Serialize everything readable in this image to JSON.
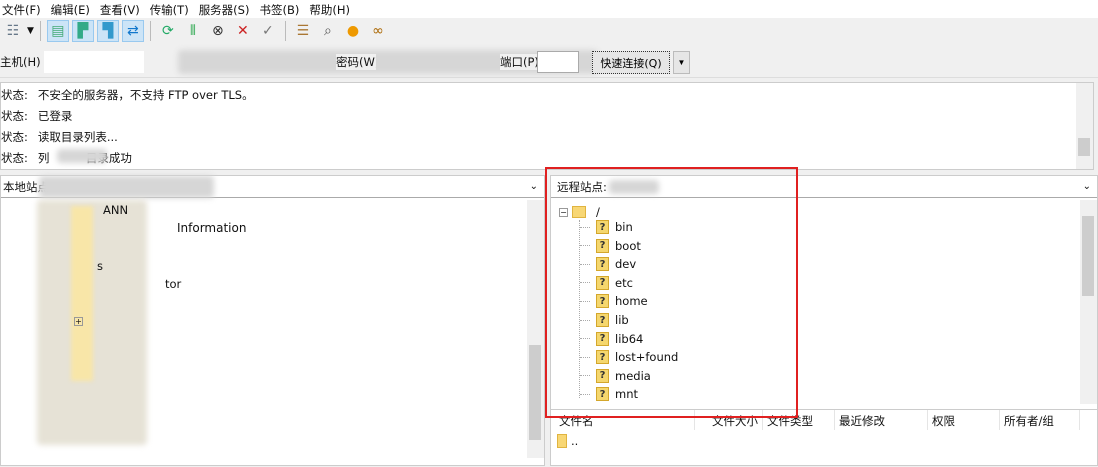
{
  "menu": [
    "文件(F)",
    "编辑(E)",
    "查看(V)",
    "传输(T)",
    "服务器(S)",
    "书签(B)",
    "帮助(H)"
  ],
  "toolbar": {
    "icons": [
      "site-manager-icon",
      "toggle-log-icon",
      "toggle-local-tree-icon",
      "toggle-remote-tree-icon",
      "toggle-queue-icon",
      "refresh-icon",
      "filter-icon",
      "cancel-icon",
      "disconnect-icon",
      "reconnect-icon",
      "compare-icon",
      "search-icon",
      "sync-browse-icon",
      "find-icon"
    ]
  },
  "quickconnect": {
    "host_label": "主机(H):",
    "password_label": "密码(W):",
    "port_label": "端口(P):",
    "connect_button": "快速连接(Q)"
  },
  "log": [
    {
      "label": "状态:",
      "text": "不安全的服务器，不支持 FTP over TLS。"
    },
    {
      "label": "状态:",
      "text": "已登录"
    },
    {
      "label": "状态:",
      "text": "读取目录列表..."
    },
    {
      "label": "状态:",
      "text": "列          目录成功"
    }
  ],
  "local": {
    "label": "本地站点:",
    "fragments": [
      "ANN",
      "Information",
      "s",
      "tor"
    ]
  },
  "remote": {
    "label": "远程站点:",
    "root": "/",
    "dirs": [
      "bin",
      "boot",
      "dev",
      "etc",
      "home",
      "lib",
      "lib64",
      "lost+found",
      "media",
      "mnt"
    ],
    "columns": [
      "文件名",
      "文件大小",
      "文件类型",
      "最近修改",
      "权限",
      "所有者/组"
    ],
    "rows": [
      ".."
    ]
  },
  "highlight_color": "#e02020"
}
